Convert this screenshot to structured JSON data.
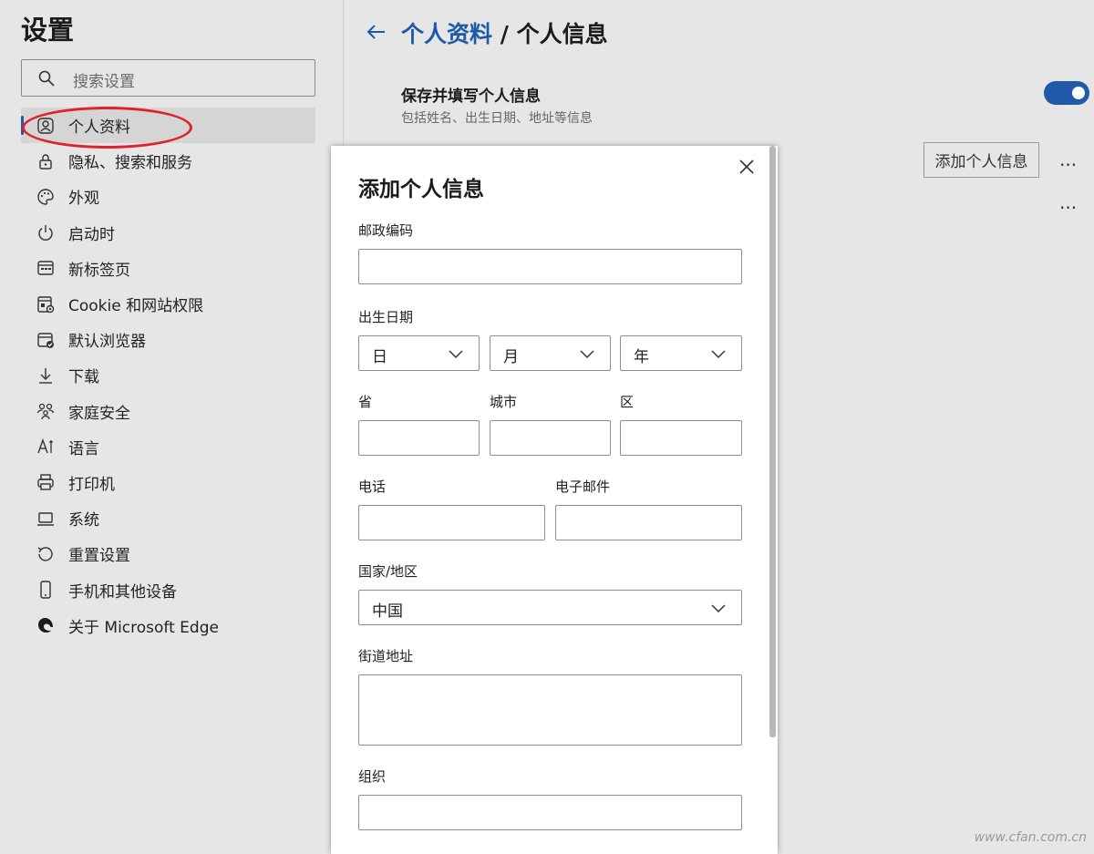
{
  "sidebar": {
    "title": "设置",
    "search_placeholder": "搜索设置",
    "items": [
      {
        "label": "个人资料",
        "icon": "profile-icon",
        "active": true
      },
      {
        "label": "隐私、搜索和服务",
        "icon": "lock-icon"
      },
      {
        "label": "外观",
        "icon": "palette-icon"
      },
      {
        "label": "启动时",
        "icon": "power-icon"
      },
      {
        "label": "新标签页",
        "icon": "new-tab-icon"
      },
      {
        "label": "Cookie 和网站权限",
        "icon": "site-permissions-icon"
      },
      {
        "label": "默认浏览器",
        "icon": "default-browser-icon"
      },
      {
        "label": "下载",
        "icon": "download-icon"
      },
      {
        "label": "家庭安全",
        "icon": "family-icon"
      },
      {
        "label": "语言",
        "icon": "language-icon"
      },
      {
        "label": "打印机",
        "icon": "printer-icon"
      },
      {
        "label": "系统",
        "icon": "laptop-icon"
      },
      {
        "label": "重置设置",
        "icon": "reset-icon"
      },
      {
        "label": "手机和其他设备",
        "icon": "phone-icon"
      },
      {
        "label": "关于 Microsoft Edge",
        "icon": "edge-logo-icon"
      }
    ]
  },
  "main": {
    "breadcrumb_link": "个人资料",
    "breadcrumb_sep": " / ",
    "breadcrumb_current": "个人信息",
    "save_title": "保存并填写个人信息",
    "save_desc": "包括姓名、出生日期、地址等信息",
    "toggle_on": true,
    "add_button": "添加个人信息",
    "more_label": "···"
  },
  "dialog": {
    "title": "添加个人信息",
    "postal_label": "邮政编码",
    "birth_label": "出生日期",
    "day": "日",
    "month": "月",
    "year": "年",
    "province_label": "省",
    "city_label": "城市",
    "district_label": "区",
    "phone_label": "电话",
    "email_label": "电子邮件",
    "country_label": "国家/地区",
    "country_value": "中国",
    "street_label": "街道地址",
    "org_label": "组织"
  },
  "watermark": "www.cfan.com.cn",
  "colors": {
    "accent": "#1e5aa8",
    "annotation": "#e0202a",
    "background": "#e6e6e6"
  }
}
